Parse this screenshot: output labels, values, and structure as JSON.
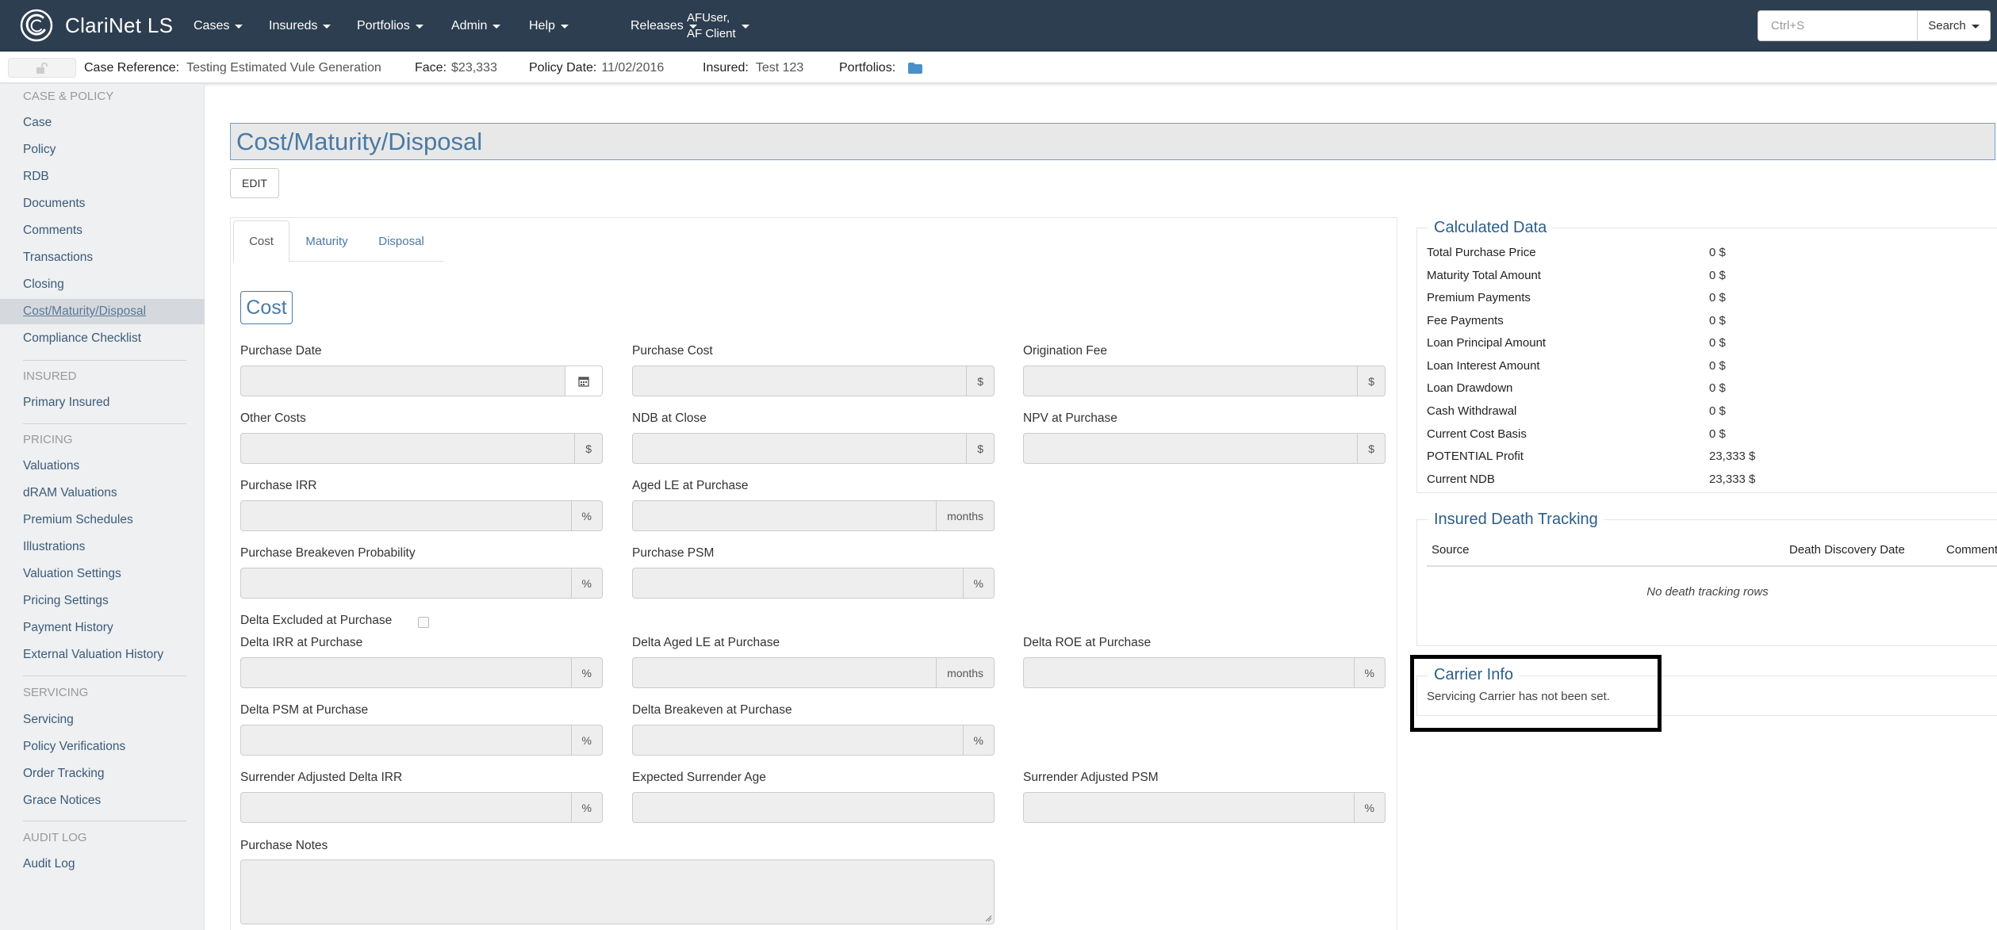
{
  "navbar": {
    "brand": "ClariNet LS",
    "menus": [
      {
        "label": "Cases"
      },
      {
        "label": "Insureds"
      },
      {
        "label": "Portfolios"
      },
      {
        "label": "Admin"
      },
      {
        "label": "Help"
      },
      {
        "label": "Releases"
      }
    ],
    "user_line1": "AFUser,",
    "user_line2": "AF Client",
    "search_placeholder": "Ctrl+S",
    "search_label": "Search"
  },
  "casebar": {
    "case_reference_label": "Case Reference:",
    "case_reference_value": "Testing Estimated Vule Generation",
    "face_label": "Face:",
    "face_value": "$23,333",
    "policy_date_label": "Policy Date:",
    "policy_date_value": "11/02/2016",
    "insured_label": "Insured:",
    "insured_value": "Test 123",
    "portfolios_label": "Portfolios:"
  },
  "sidebar": {
    "sections": [
      {
        "header": "CASE & POLICY",
        "items": [
          "Case",
          "Policy",
          "RDB",
          "Documents",
          "Comments",
          "Transactions",
          "Closing",
          "Cost/Maturity/Disposal",
          "Compliance Checklist"
        ]
      },
      {
        "header": "INSURED",
        "items": [
          "Primary Insured"
        ]
      },
      {
        "header": "PRICING",
        "items": [
          "Valuations",
          "dRAM Valuations",
          "Premium Schedules",
          "Illustrations",
          "Valuation Settings",
          "Pricing Settings",
          "Payment History",
          "External Valuation History"
        ]
      },
      {
        "header": "SERVICING",
        "items": [
          "Servicing",
          "Policy Verifications",
          "Order Tracking",
          "Grace Notices"
        ]
      },
      {
        "header": "AUDIT LOG",
        "items": [
          "Audit Log"
        ]
      }
    ],
    "active_item": "Cost/Maturity/Disposal"
  },
  "main": {
    "title": "Cost/Maturity/Disposal",
    "edit_label": "EDIT",
    "tabs": [
      "Cost",
      "Maturity",
      "Disposal"
    ],
    "active_tab": "Cost",
    "section_title": "Cost",
    "fields": {
      "purchase_date": "Purchase Date",
      "purchase_cost": "Purchase Cost",
      "origination_fee": "Origination Fee",
      "other_costs": "Other Costs",
      "ndb_at_close": "NDB at Close",
      "npv_at_purchase": "NPV at Purchase",
      "purchase_irr": "Purchase IRR",
      "aged_le_at_purchase": "Aged LE at Purchase",
      "purchase_breakeven_probability": "Purchase Breakeven Probability",
      "purchase_psm": "Purchase PSM",
      "delta_excluded_at_purchase": "Delta Excluded at Purchase",
      "delta_irr_at_purchase": "Delta IRR at Purchase",
      "delta_aged_le_at_purchase": "Delta Aged LE at Purchase",
      "delta_roe_at_purchase": "Delta ROE at Purchase",
      "delta_psm_at_purchase": "Delta PSM at Purchase",
      "delta_breakeven_at_purchase": "Delta Breakeven at Purchase",
      "surrender_adjusted_delta_irr": "Surrender Adjusted Delta IRR",
      "expected_surrender_age": "Expected Surrender Age",
      "surrender_adjusted_psm": "Surrender Adjusted PSM",
      "purchase_notes": "Purchase Notes"
    },
    "addons": {
      "dollar": "$",
      "percent": "%",
      "months": "months"
    }
  },
  "calculated_data": {
    "title": "Calculated Data",
    "rows": [
      {
        "label": "Total Purchase Price",
        "value": "0 $"
      },
      {
        "label": "Maturity Total Amount",
        "value": "0 $"
      },
      {
        "label": "Premium Payments",
        "value": "0 $"
      },
      {
        "label": "Fee Payments",
        "value": "0 $"
      },
      {
        "label": "Loan Principal Amount",
        "value": "0 $"
      },
      {
        "label": "Loan Interest Amount",
        "value": "0 $"
      },
      {
        "label": "Loan Drawdown",
        "value": "0 $"
      },
      {
        "label": "Cash Withdrawal",
        "value": "0 $"
      },
      {
        "label": "Current Cost Basis",
        "value": "0 $"
      },
      {
        "label": "POTENTIAL Profit",
        "value": "23,333 $"
      },
      {
        "label": "Current NDB",
        "value": "23,333 $"
      }
    ]
  },
  "death_tracking": {
    "title": "Insured Death Tracking",
    "columns": [
      "Source",
      "Death Discovery Date",
      "Comment"
    ],
    "empty_text": "No death tracking rows"
  },
  "carrier_info": {
    "title": "Carrier Info",
    "text": "Servicing Carrier has not been set."
  }
}
